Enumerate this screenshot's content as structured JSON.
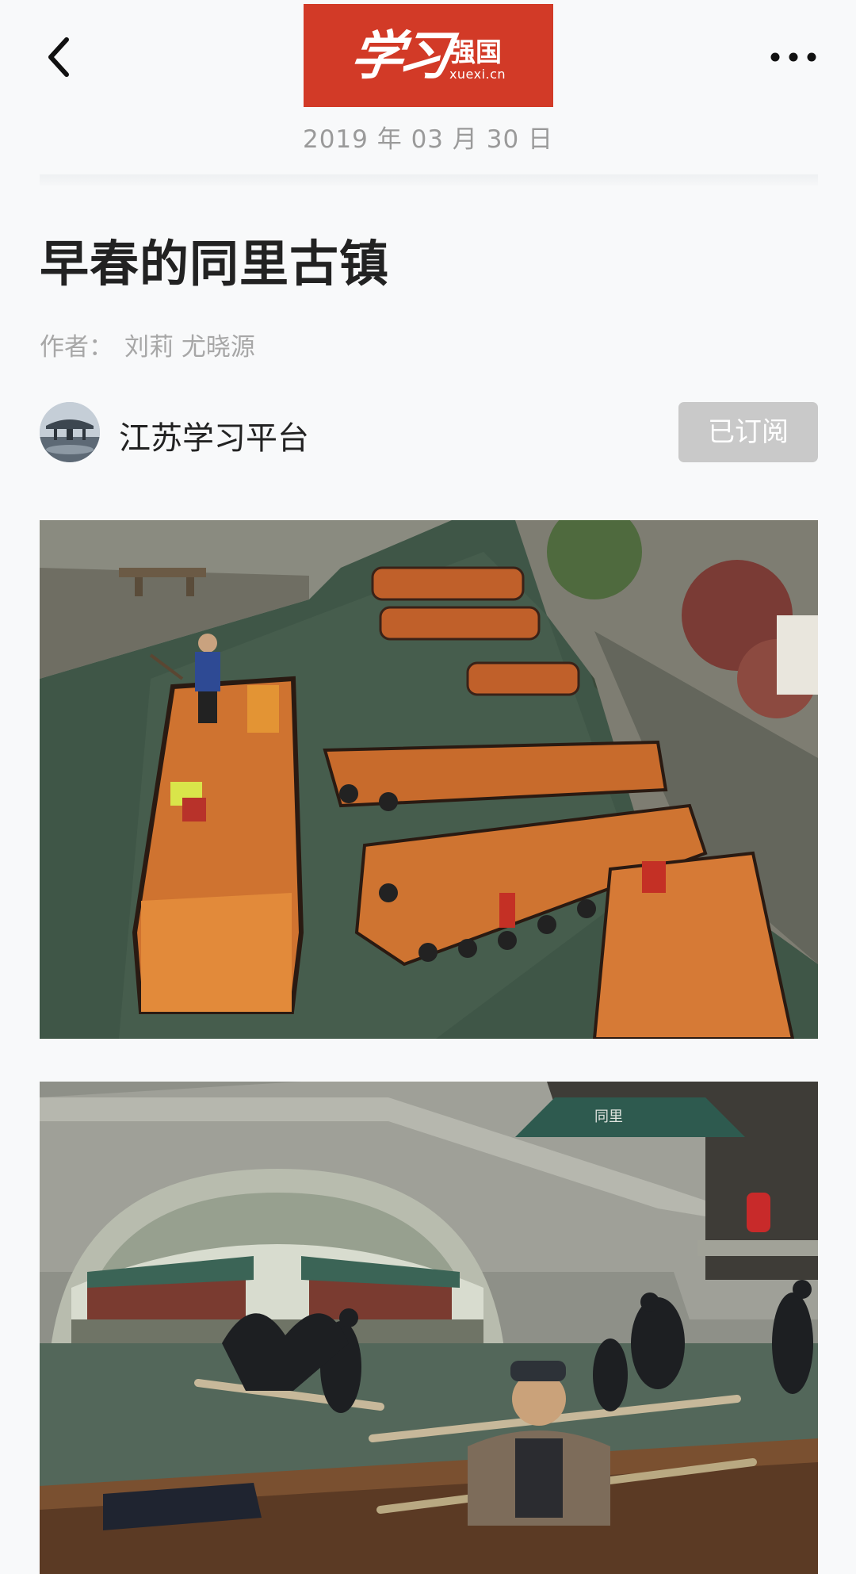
{
  "header": {
    "back_icon": "chevron-left-icon",
    "more_icon": "more-horizontal-icon",
    "logo": {
      "script_text": "学习",
      "cn_text": "强国",
      "en_text": "xuexi.cn",
      "bg_color": "#d23a27"
    },
    "date": "2019 年 03 月 30 日"
  },
  "article": {
    "title": "早春的同里古镇",
    "author_label": "作者：",
    "author_names": "刘莉 尤晓源",
    "source": {
      "name": "江苏学习平台",
      "subscribe_label": "已订阅",
      "subscribe_color": "#c9c9c9"
    },
    "photos": [
      {
        "icon": "canal-boats-photo"
      },
      {
        "icon": "stone-bridge-cormorant-photo",
        "sign_text": "同里"
      }
    ]
  }
}
